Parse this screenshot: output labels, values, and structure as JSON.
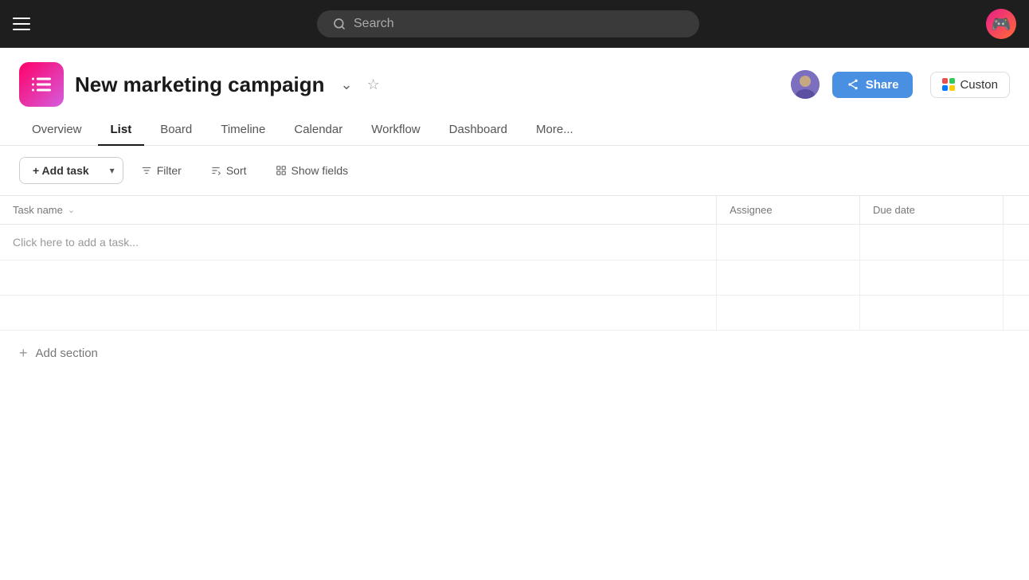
{
  "topnav": {
    "search_placeholder": "Search"
  },
  "header": {
    "project_title": "New marketing campaign",
    "share_label": "Share",
    "custom_label": "Custon"
  },
  "tabs": [
    {
      "id": "overview",
      "label": "Overview",
      "active": false
    },
    {
      "id": "list",
      "label": "List",
      "active": true
    },
    {
      "id": "board",
      "label": "Board",
      "active": false
    },
    {
      "id": "timeline",
      "label": "Timeline",
      "active": false
    },
    {
      "id": "calendar",
      "label": "Calendar",
      "active": false
    },
    {
      "id": "workflow",
      "label": "Workflow",
      "active": false
    },
    {
      "id": "dashboard",
      "label": "Dashboard",
      "active": false
    },
    {
      "id": "more",
      "label": "More...",
      "active": false
    }
  ],
  "toolbar": {
    "add_task_label": "+ Add task",
    "filter_label": "Filter",
    "sort_label": "Sort",
    "show_fields_label": "Show fields"
  },
  "table": {
    "columns": [
      {
        "id": "task_name",
        "label": "Task name",
        "has_chevron": true
      },
      {
        "id": "assignee",
        "label": "Assignee",
        "has_chevron": false
      },
      {
        "id": "due_date",
        "label": "Due date",
        "has_chevron": false
      }
    ],
    "add_task_placeholder": "Click here to add a task...",
    "empty_rows": 2
  },
  "add_section": {
    "label": "Add section"
  }
}
